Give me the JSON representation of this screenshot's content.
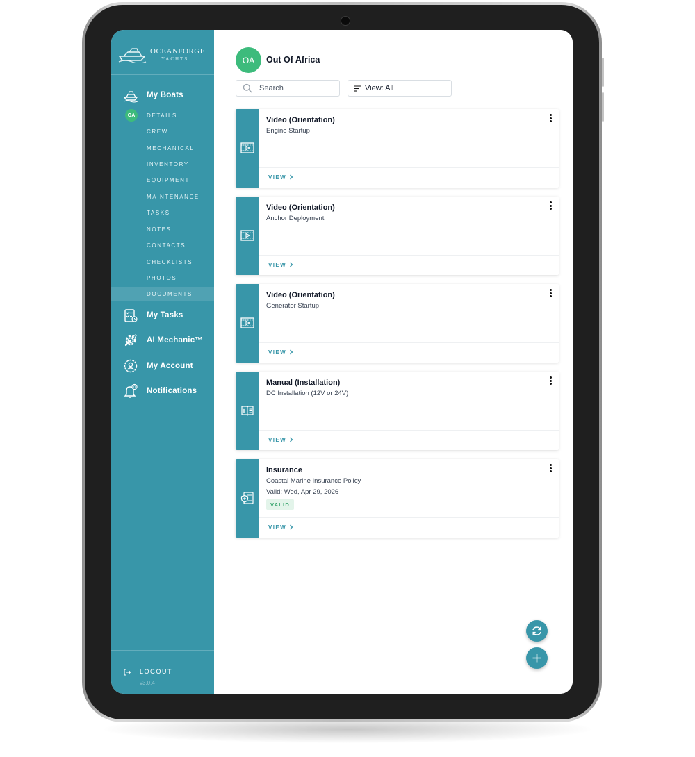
{
  "brand": {
    "name": "OCEANFORGE",
    "subtitle": "YACHTS"
  },
  "sidebar": {
    "main_items": [
      {
        "label": "My Boats",
        "icon": "boat-icon"
      },
      {
        "label": "My Tasks",
        "icon": "tasks-clipboard-icon"
      },
      {
        "label": "AI Mechanic™",
        "icon": "wrench-gear-icon"
      },
      {
        "label": "My Account",
        "icon": "account-gear-icon"
      },
      {
        "label": "Notifications",
        "icon": "bell-icon",
        "badge": "0"
      }
    ],
    "boat_initials": "OA",
    "sub_items": [
      {
        "label": "DETAILS"
      },
      {
        "label": "CREW"
      },
      {
        "label": "MECHANICAL"
      },
      {
        "label": "INVENTORY"
      },
      {
        "label": "EQUIPMENT"
      },
      {
        "label": "MAINTENANCE"
      },
      {
        "label": "TASKS"
      },
      {
        "label": "NOTES"
      },
      {
        "label": "CONTACTS"
      },
      {
        "label": "CHECKLISTS"
      },
      {
        "label": "PHOTOS"
      },
      {
        "label": "DOCUMENTS",
        "active": true
      }
    ],
    "logout_label": "LOGOUT",
    "version": "v3.0.4"
  },
  "header": {
    "avatar_initials": "OA",
    "boat_name": "Out Of Africa",
    "search_placeholder": "Search",
    "view_label": "View: All"
  },
  "documents": [
    {
      "title": "Video (Orientation)",
      "subtitle": "Engine Startup",
      "icon": "video-icon",
      "view_label": "VIEW"
    },
    {
      "title": "Video (Orientation)",
      "subtitle": "Anchor Deployment",
      "icon": "video-icon",
      "view_label": "VIEW"
    },
    {
      "title": "Video (Orientation)",
      "subtitle": "Generator Startup",
      "icon": "video-icon",
      "view_label": "VIEW"
    },
    {
      "title": "Manual (Installation)",
      "subtitle": "DC Installation (12V or 24V)",
      "icon": "manual-icon",
      "view_label": "VIEW"
    },
    {
      "title": "Insurance",
      "subtitle": "Coastal Marine Insurance Policy",
      "valid_date": "Valid: Wed, Apr 29, 2026",
      "status": "VALID",
      "icon": "insurance-icon",
      "view_label": "VIEW"
    }
  ],
  "colors": {
    "accent": "#3896a9",
    "avatar": "#3dbb7c",
    "valid_badge_text": "#3aa66f",
    "valid_badge_bg": "#e3f4ea"
  }
}
